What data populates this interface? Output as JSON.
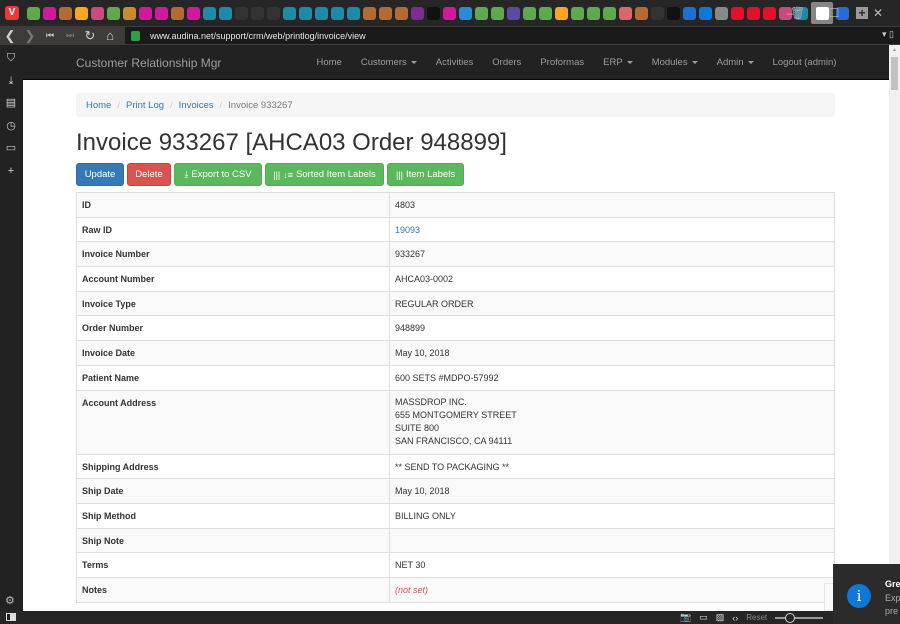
{
  "browser": {
    "url": "www.audina.net/support/crm/web/printlog/invoice/view",
    "window_controls": {
      "minimize": "–",
      "maximize": "☐",
      "close": "✕"
    },
    "tab_favicon_colors": [
      "#5fa84d",
      "#d0199b",
      "#b36b36",
      "#f5a623",
      "#c74b7e",
      "#5fa84d",
      "#c78a35",
      "#d0199b",
      "#d0199b",
      "#b36b36",
      "#d0199b",
      "#1e8aa5",
      "#1e8aa5",
      "#333333",
      "#333333",
      "#333333",
      "#1e8aa5",
      "#1e8aa5",
      "#1e8aa5",
      "#1e8aa5",
      "#1e8aa5",
      "#b36b36",
      "#b36b36",
      "#b36b36",
      "#7c2e8e",
      "#111111",
      "#d0199b",
      "#2a8ad4",
      "#5fa84d",
      "#5fa84d",
      "#5b4aa0",
      "#5fa84d",
      "#5fa84d",
      "#f5a623",
      "#5fa84d",
      "#5fa84d",
      "#5fa84d",
      "#d66a6a",
      "#b36b36",
      "#333333",
      "#111111",
      "#1f6fd1",
      "#0f78d4",
      "#888888",
      "#e0102f",
      "#e0102f",
      "#e0102f",
      "#c74b7e",
      "#1e8aa5",
      "#2a6ad4"
    ]
  },
  "sidepanel": {
    "icons": [
      "bookmark-icon",
      "download-icon",
      "notes-icon",
      "history-icon",
      "window-icon",
      "add-panel-icon"
    ]
  },
  "app": {
    "brand": "Customer Relationship Mgr",
    "nav": [
      {
        "label": "Home",
        "dropdown": false
      },
      {
        "label": "Customers",
        "dropdown": true
      },
      {
        "label": "Activities",
        "dropdown": false
      },
      {
        "label": "Orders",
        "dropdown": false
      },
      {
        "label": "Proformas",
        "dropdown": false
      },
      {
        "label": "ERP",
        "dropdown": true
      },
      {
        "label": "Modules",
        "dropdown": true
      },
      {
        "label": "Admin",
        "dropdown": true
      },
      {
        "label": "Logout (admin)",
        "dropdown": false
      }
    ]
  },
  "breadcrumb": {
    "items": [
      "Home",
      "Print Log",
      "Invoices"
    ],
    "active": "Invoice 933267"
  },
  "page_title": "Invoice 933267 [AHCA03 Order 948899]",
  "buttons": {
    "update": "Update",
    "delete": "Delete",
    "export_csv": "Export to CSV",
    "sorted_labels": "Sorted Item Labels",
    "item_labels": "Item Labels"
  },
  "details": [
    {
      "label": "ID",
      "value": "4803"
    },
    {
      "label": "Raw ID",
      "value": "19093",
      "link": true
    },
    {
      "label": "Invoice Number",
      "value": "933267"
    },
    {
      "label": "Account Number",
      "value": "AHCA03-0002"
    },
    {
      "label": "Invoice Type",
      "value": "REGULAR ORDER"
    },
    {
      "label": "Order Number",
      "value": "948899"
    },
    {
      "label": "Invoice Date",
      "value": "May 10, 2018"
    },
    {
      "label": "Patient Name",
      "value": "600 SETS #MDPO-57992"
    },
    {
      "label": "Account Address",
      "lines": [
        "MASSDROP INC.",
        "655 MONTGOMERY STREET",
        "SUITE 800",
        "SAN FRANCISCO, CA 94111"
      ]
    },
    {
      "label": "Shipping Address",
      "value": "** SEND TO PACKAGING **"
    },
    {
      "label": "Ship Date",
      "value": "May 10, 2018"
    },
    {
      "label": "Ship Method",
      "value": "BILLING ONLY"
    },
    {
      "label": "Ship Note",
      "value": ""
    },
    {
      "label": "Terms",
      "value": "NET 30"
    },
    {
      "label": "Notes",
      "value": "(not set)",
      "notset": true
    }
  ],
  "statusbar": {
    "reset_label": "Reset"
  },
  "notification": {
    "title": "Gre",
    "body_lines": [
      "Exp",
      "pre"
    ]
  }
}
